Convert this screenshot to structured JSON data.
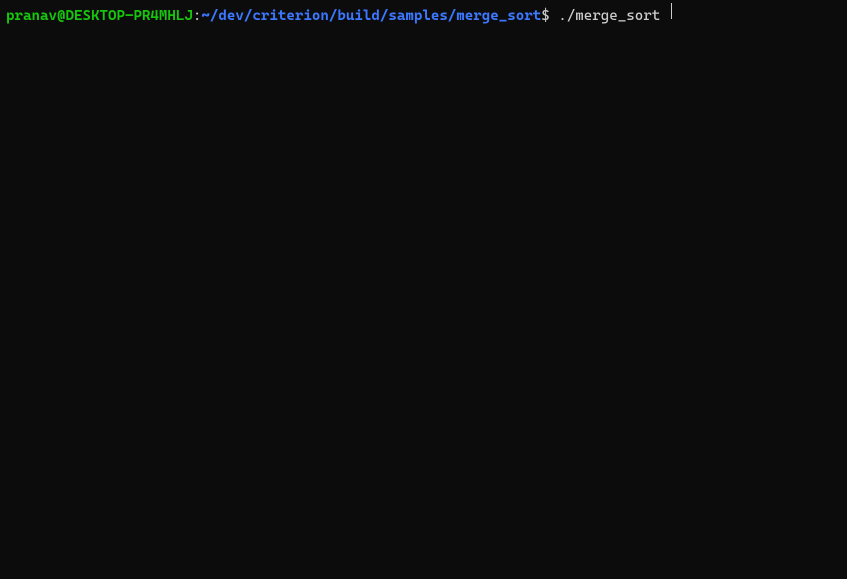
{
  "prompt": {
    "user_host": "pranav@DESKTOP-PR4MHLJ",
    "separator": ":",
    "path": "~/dev/criterion/build/samples/merge_sort",
    "symbol": "$",
    "command": " ./merge_sort "
  }
}
